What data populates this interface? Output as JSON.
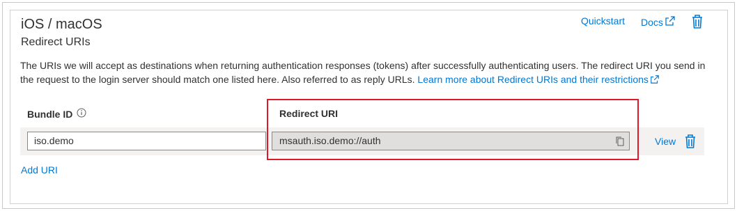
{
  "section": {
    "title": "iOS / macOS",
    "subtitle": "Redirect URIs"
  },
  "header_links": {
    "quickstart": "Quickstart",
    "docs": "Docs"
  },
  "description": {
    "text": "The URIs we will accept as destinations when returning authentication responses (tokens) after successfully authenticating users. The redirect URI you send in the request to the login server should match one listed here. Also referred to as reply URLs.",
    "link_text": "Learn more about Redirect URIs and their restrictions"
  },
  "table": {
    "columns": [
      "Bundle ID",
      "Redirect URI"
    ],
    "rows": [
      {
        "bundle_id": "iso.demo",
        "redirect_uri": "msauth.iso.demo://auth",
        "view_label": "View"
      }
    ]
  },
  "add_uri_label": "Add URI",
  "colors": {
    "accent": "#0078d4",
    "highlight": "#e0182b",
    "row_background": "#f3f2f1"
  },
  "icons": [
    "external-link-icon",
    "delete-icon",
    "info-icon",
    "copy-icon"
  ]
}
